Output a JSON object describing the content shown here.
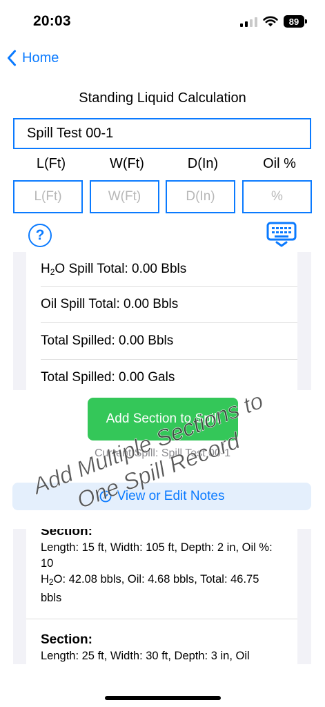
{
  "status_bar": {
    "time": "20:03",
    "battery": "89"
  },
  "nav": {
    "back_label": "Home"
  },
  "page": {
    "title": "Standing Liquid Calculation"
  },
  "spill_name": {
    "value": "Spill Test 00-1"
  },
  "dimensions": {
    "labels": [
      "L(Ft)",
      "W(Ft)",
      "D(In)",
      "Oil %"
    ],
    "placeholders": [
      "L(Ft)",
      "W(Ft)",
      "D(In)",
      "%"
    ]
  },
  "help": {
    "label": "?"
  },
  "totals": {
    "h2o_prefix": "H",
    "h2o_sub": "2",
    "h2o_suffix": "O Spill Total: 0.00 Bbls",
    "oil": "Oil Spill Total: 0.00 Bbls",
    "total_bbls": "Total Spilled: 0.00 Bbls",
    "total_gals": "Total Spilled: 0.00 Gals"
  },
  "actions": {
    "add_section_label": "Add Section to Spill",
    "current_spill": "Current Spill: Spill Test 00-1",
    "notes_label": "View or Edit Notes"
  },
  "sections": [
    {
      "header": "Section:",
      "dims": "Length: 15 ft, Width: 105 ft, Depth: 2 in, Oil %: 10",
      "result_prefix": "H",
      "result_sub": "2",
      "result_suffix": "O: 42.08 bbls, Oil: 4.68 bbls, Total: 46.75 bbls"
    },
    {
      "header": "Section:",
      "dims": "Length: 25 ft, Width: 30 ft, Depth: 3 in, Oil"
    }
  ],
  "overlay": {
    "line1": "Add Multiple Sections to",
    "line2": "One Spill Record"
  },
  "colors": {
    "accent": "#0a7aff",
    "success": "#34c759",
    "panel": "#f2f2f7"
  }
}
